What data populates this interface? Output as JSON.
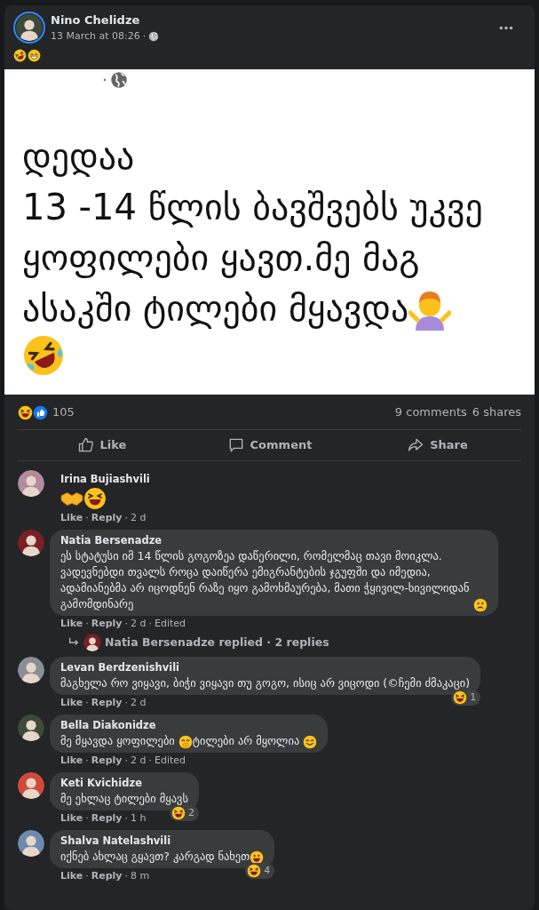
{
  "separator": "·",
  "post": {
    "author": "Nino Chelidze",
    "time": "13 March at 08:26",
    "emojis": [
      {
        "kind": "rofl"
      },
      {
        "kind": "grin"
      }
    ],
    "image": {
      "lines": [
        [
          {
            "kind": "text",
            "text": "დედაა"
          }
        ],
        [
          {
            "kind": "text",
            "text": "13 -14 წლის ბავშვებს უკვე"
          }
        ],
        [
          {
            "kind": "text",
            "text": "ყოფილები ყავთ.მე მაგ"
          }
        ],
        [
          {
            "kind": "text",
            "text": "ასაკში ტილები მყავდა"
          },
          {
            "kind": "shrug"
          }
        ],
        [
          {
            "kind": "rofl"
          }
        ]
      ]
    },
    "reactions": [
      {
        "kind": "laugh"
      },
      {
        "kind": "like"
      }
    ],
    "reaction_count": "105",
    "comments": "9 comments",
    "shares": "6 shares",
    "actions": [
      {
        "kind": "like",
        "label": "Like"
      },
      {
        "kind": "comment",
        "label": "Comment"
      },
      {
        "kind": "share",
        "label": "Share"
      }
    ]
  },
  "comments": [
    {
      "author": "Irina Bujiashvili",
      "segments": [
        {
          "kind": "handshake"
        },
        {
          "kind": "laugh"
        }
      ],
      "like": "Like",
      "reply": "Reply",
      "meta": [
        "2 d"
      ]
    },
    {
      "author": "Natia Bersenadze",
      "segments": [
        {
          "kind": "text",
          "text": "ეს სტატუსი იმ 14 წლის გოგოზეა დაწერილი, რომელმაც თავი მოიკლა. ვადევნებდი თვალს როცა დაიწერა ემიგრანტების ჯგუფში და იმედია, ადამიანებმა არ იცოდნენ რაზე იყო გამოხმაურება, მათი ჭყივილ-ხივილიდან გამომდინარე "
        },
        {
          "kind": "sad"
        }
      ],
      "like": "Like",
      "reply": "Reply",
      "meta": [
        "2 d",
        "Edited"
      ],
      "replies": "Natia Bersenadze replied · 2 replies"
    },
    {
      "author": "Levan Berdzenishvili",
      "segments": [
        {
          "kind": "text",
          "text": "მაგხელა რო ვიყავი, ბიჭი ვიყავი თუ გოგო, ისიც არ ვიცოდი (©ჩემი ძმაკაცი)"
        }
      ],
      "like": "Like",
      "reply": "Reply",
      "meta": [
        "2 d"
      ],
      "reaction": {
        "kind": "laugh",
        "count": "1"
      }
    },
    {
      "author": "Bella Diakonidze",
      "segments": [
        {
          "kind": "text",
          "text": "მე მყავდა ყოფილები "
        },
        {
          "kind": "hand_over_mouth"
        },
        {
          "kind": "text",
          "text": "ტილები არ მყოლია "
        },
        {
          "kind": "smile"
        }
      ],
      "like": "Like",
      "reply": "Reply",
      "meta": [
        "2 d",
        "Edited"
      ]
    },
    {
      "author": "Keti Kvichidze",
      "segments": [
        {
          "kind": "text",
          "text": "მე ეხლაც ტილები მყავს"
        }
      ],
      "like": "Like",
      "reply": "Reply",
      "meta": [
        "1 h"
      ],
      "reaction": {
        "kind": "laugh",
        "count": "2"
      }
    },
    {
      "author": "Shalva Natelashvili",
      "segments": [
        {
          "kind": "text",
          "text": "იქნებ ახლაც გყავთ? კარგად ნახეთ"
        },
        {
          "kind": "grin_big"
        }
      ],
      "like": "Like",
      "reply": "Reply",
      "meta": [
        "8 m"
      ],
      "reaction": {
        "kind": "laugh",
        "count": "4"
      }
    }
  ]
}
